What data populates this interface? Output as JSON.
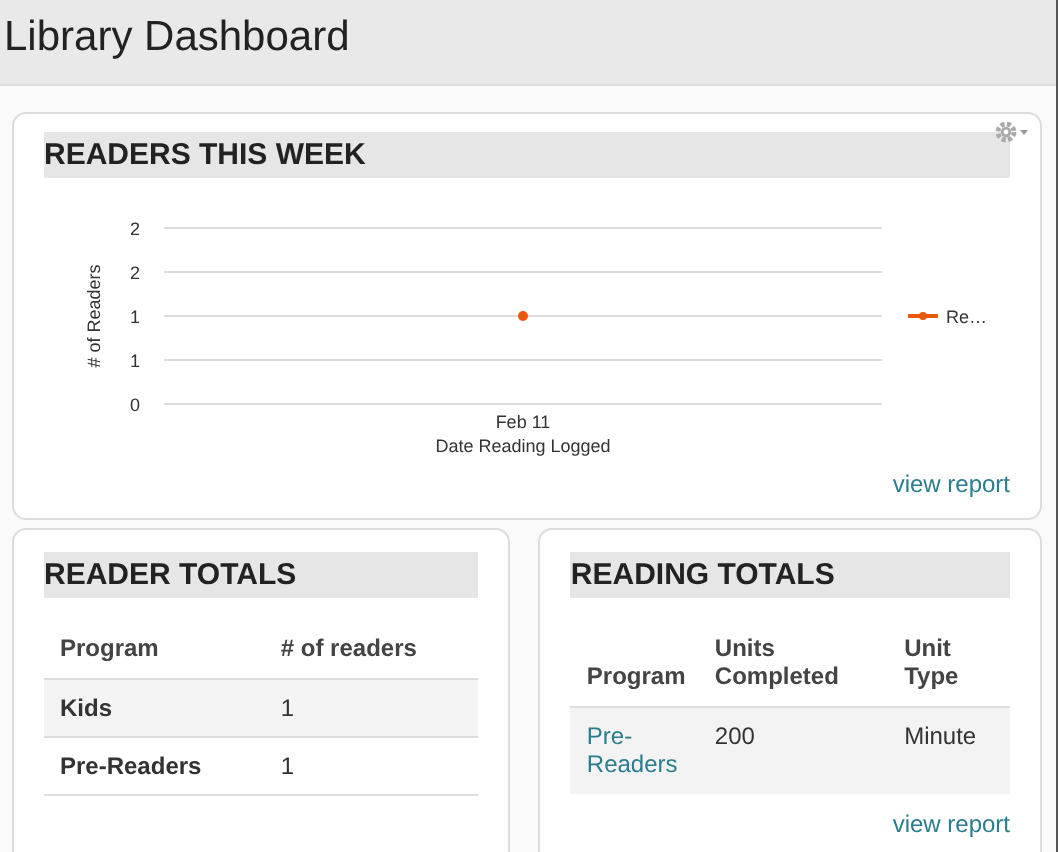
{
  "page": {
    "title": "Library Dashboard"
  },
  "readers_this_week": {
    "title": "READERS THIS WEEK",
    "link": "view report",
    "chart_data": {
      "type": "line",
      "grid": true,
      "xlabel": "Date Reading Logged",
      "ylabel": "# of Readers",
      "categories": [
        "Feb 11"
      ],
      "ylim": [
        0,
        2
      ],
      "yticks": [
        {
          "value": 0,
          "label": "0"
        },
        {
          "value": 0.5,
          "label": "1"
        },
        {
          "value": 1,
          "label": "1"
        },
        {
          "value": 1.5,
          "label": "2"
        },
        {
          "value": 2,
          "label": "2"
        }
      ],
      "series": [
        {
          "name": "Re…",
          "color": "#e8590c",
          "marker": "circle",
          "values": [
            1
          ]
        }
      ]
    }
  },
  "reader_totals": {
    "title": "READER TOTALS",
    "columns": [
      "Program",
      "# of readers"
    ],
    "rows": [
      {
        "program": "Kids",
        "count": "1"
      },
      {
        "program": "Pre-Readers",
        "count": "1"
      }
    ]
  },
  "reading_totals": {
    "title": "READING TOTALS",
    "columns": [
      "Program",
      "Units Completed",
      "Unit Type"
    ],
    "rows": [
      {
        "program": "Pre-Readers",
        "units": "200",
        "unit_type": "Minute"
      }
    ],
    "link": "view report"
  }
}
